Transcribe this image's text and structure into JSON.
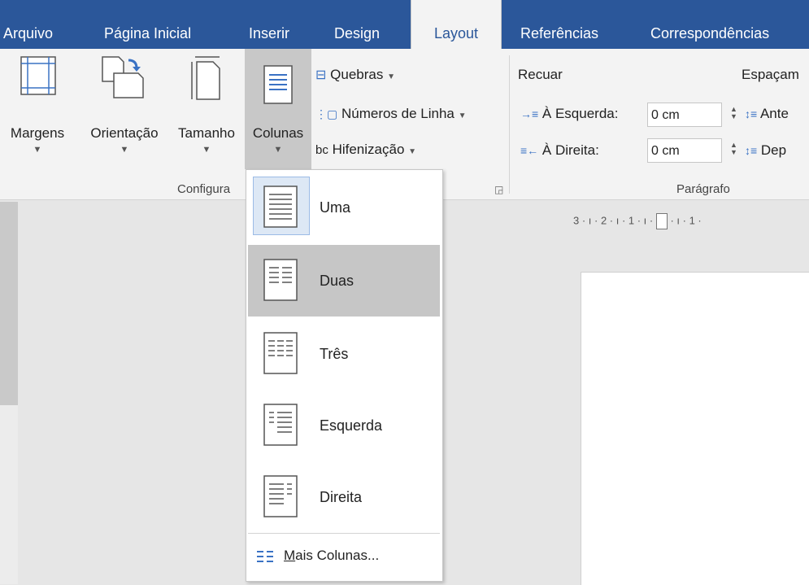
{
  "tabs": [
    "Arquivo",
    "Página Inicial",
    "Inserir",
    "Design",
    "Layout",
    "Referências",
    "Correspondências"
  ],
  "active_tab": "Layout",
  "page_setup": {
    "margens": "Margens",
    "orientacao": "Orientação",
    "tamanho": "Tamanho",
    "colunas": "Colunas",
    "quebras": "Quebras",
    "numeros_linha": "Números de Linha",
    "hifenizacao": "Hifenização",
    "group_label": "Configura"
  },
  "paragraph": {
    "recuar": "Recuar",
    "espacamento": "Espaçam",
    "esquerda_label": "À Esquerda:",
    "esquerda_value": "0 cm",
    "direita_label": "À Direita:",
    "direita_value": "0 cm",
    "antes": "Ante",
    "depois": "Dep",
    "group_label": "Parágrafo"
  },
  "ruler": {
    "tab_marker": "L",
    "horizontal_ticks": "3 · ı · 2 · ı · 1 · ı ·",
    "horizontal_after": "· ı · 1 ·"
  },
  "columns_menu": {
    "items": [
      "Uma",
      "Duas",
      "Três",
      "Esquerda",
      "Direita"
    ],
    "selected": "Uma",
    "hovered": "Duas",
    "more_mnemonic": "M",
    "more_rest": "ais Colunas..."
  }
}
